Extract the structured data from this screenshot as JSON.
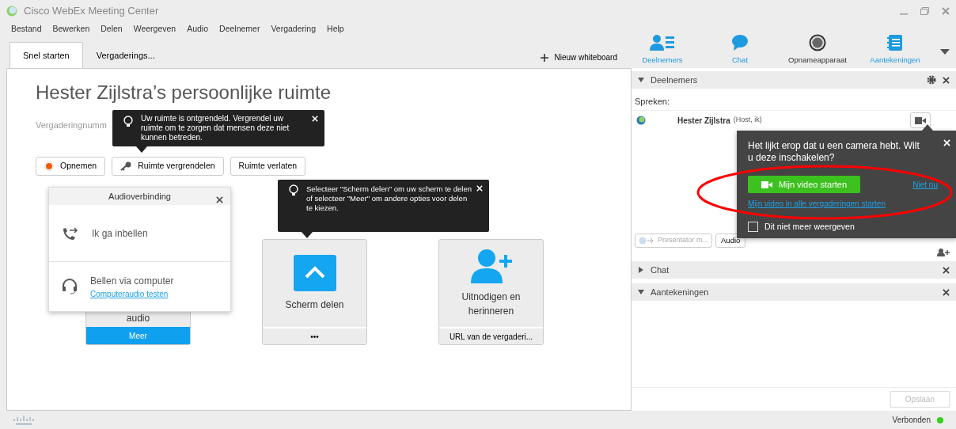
{
  "window": {
    "title": "Cisco WebEx Meeting Center"
  },
  "menu": [
    "Bestand",
    "Bewerken",
    "Delen",
    "Weergeven",
    "Audio",
    "Deelnemer",
    "Vergadering",
    "Help"
  ],
  "tabs": [
    {
      "label": "Snel starten",
      "selected": true
    },
    {
      "label": "Vergaderings...",
      "selected": false
    }
  ],
  "toolbar": {
    "new_whiteboard": "Nieuw whiteboard",
    "items": [
      {
        "kind": "participants",
        "label": "Deelnemers",
        "active": true
      },
      {
        "kind": "chat",
        "label": "Chat",
        "active": true
      },
      {
        "kind": "recorder",
        "label": "Opnameapparaat",
        "active": false
      },
      {
        "kind": "notes",
        "label": "Aantekeningen",
        "active": true
      }
    ]
  },
  "room": {
    "title": "Hester Zijlstra’s persoonlijke ruimte",
    "meeting_number": "Vergaderingnumm",
    "buttons": [
      {
        "kind": "record",
        "label": "Opnemen"
      },
      {
        "kind": "lock",
        "label": "Ruimte vergrendelen"
      },
      {
        "kind": "plain",
        "label": "Ruimte verlaten"
      }
    ]
  },
  "lock_tip": {
    "text": "Uw ruimte is ontgrendeld. Vergrendel uw ruimte om te zorgen dat mensen deze niet kunnen betreden."
  },
  "share_tip": {
    "text": "Selecteer \"Scherm delen\" om uw scherm te delen of selecteer \"Meer\" om andere opties voor delen te kiezen."
  },
  "tiles": [
    {
      "kind": "audio",
      "label": "audio",
      "footer": "Meer"
    },
    {
      "kind": "share",
      "label": "Scherm delen",
      "footer": "•••"
    },
    {
      "kind": "invite",
      "label": "Uitnodigen en herinneren",
      "footer": "URL van de vergaderi..."
    }
  ],
  "audio_popup": {
    "title": "Audioverbinding",
    "options": [
      {
        "kind": "dial",
        "label": "Ik ga inbellen"
      },
      {
        "kind": "computer",
        "label": "Bellen via computer",
        "link": "Computeraudio testen"
      }
    ]
  },
  "panel": {
    "title": "Deelnemers",
    "speaking_label": "Spreken:",
    "participants": [
      {
        "name": "Hester Zijlstra",
        "role": "(Host, ik)"
      }
    ],
    "presenter_button": "Presentator m...",
    "audio_button": "Audio"
  },
  "camera_popup": {
    "message": "Het lijkt erop dat u een camera hebt. Wilt u deze inschakelen?",
    "start_button": "Mijn video starten",
    "not_now": "Niet nu",
    "always_link": "Mijn video in alle vergaderingen starten",
    "dont_show": {
      "label": "Dit niet meer weergeven",
      "checked": false
    }
  },
  "sections": [
    {
      "title": "Chat",
      "expanded": false
    },
    {
      "title": "Aantekeningen",
      "expanded": true
    }
  ],
  "save_button": {
    "label": "Opslaan",
    "disabled": true
  },
  "status_bar": {
    "text": "Verbonden",
    "connected": true
  }
}
